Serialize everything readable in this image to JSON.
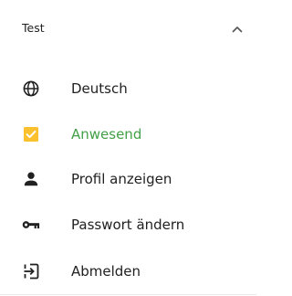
{
  "header": {
    "user_name": "Test",
    "collapse_icon": "chevron-up-icon"
  },
  "menu": {
    "items": [
      {
        "label": "Deutsch",
        "icon": "globe-icon"
      },
      {
        "label": "Anwesend",
        "icon": "checkbox-checked-icon",
        "color": "#43a047",
        "icon_color": "#fbc02d"
      },
      {
        "label": "Profil anzeigen",
        "icon": "person-icon"
      },
      {
        "label": "Passwort ändern",
        "icon": "key-icon"
      },
      {
        "label": "Abmelden",
        "icon": "logout-icon"
      }
    ]
  }
}
